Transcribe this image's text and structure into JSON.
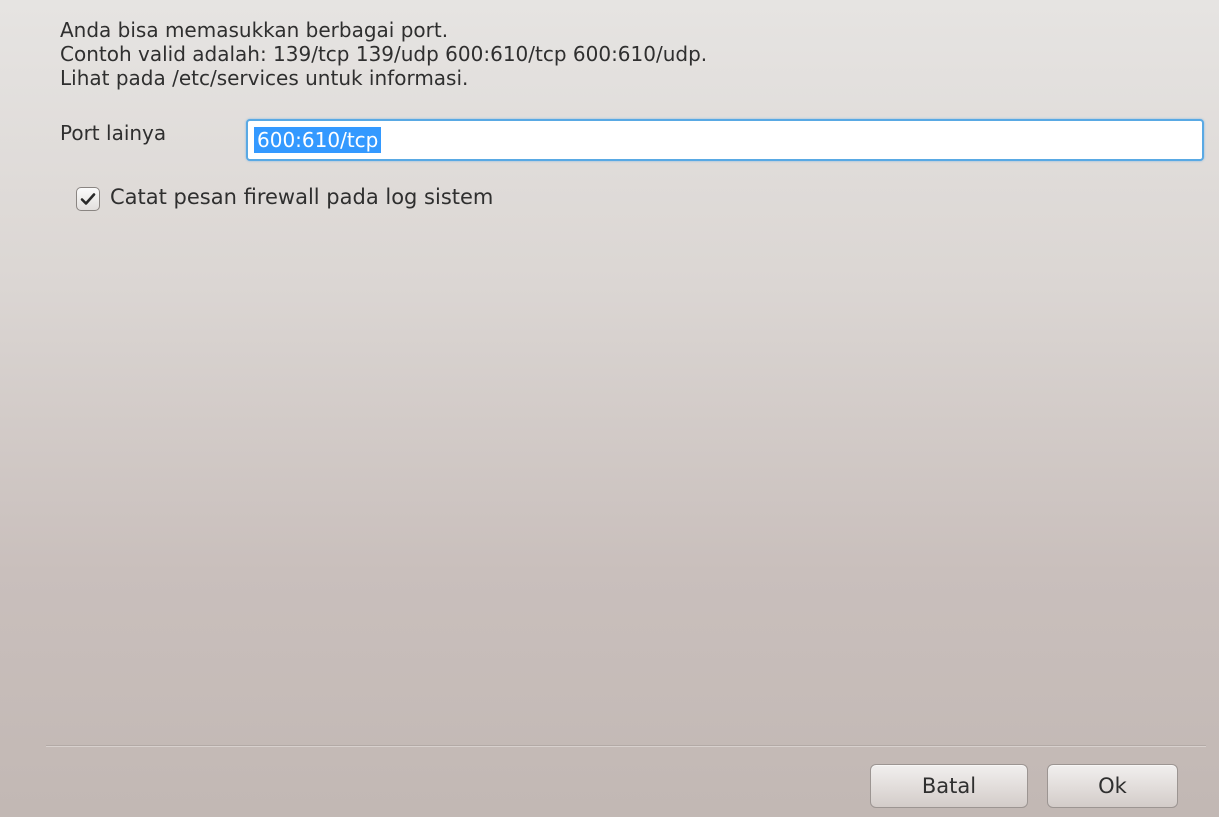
{
  "info": {
    "line1": "Anda bisa memasukkan berbagai port.",
    "line2": "Contoh valid adalah: 139/tcp 139/udp 600:610/tcp 600:610/udp.",
    "line3": "Lihat pada /etc/services untuk informasi."
  },
  "port_field": {
    "label": "Port lainya",
    "value": "600:610/tcp",
    "selected": true
  },
  "log_checkbox": {
    "label": "Catat pesan firewall pada log sistem",
    "checked": true
  },
  "buttons": {
    "cancel_label": "Batal",
    "ok_label": "Ok"
  },
  "colors": {
    "focus_border": "#59a9e4",
    "selection_bg": "#3399ff",
    "selection_text": "#ffffff"
  }
}
